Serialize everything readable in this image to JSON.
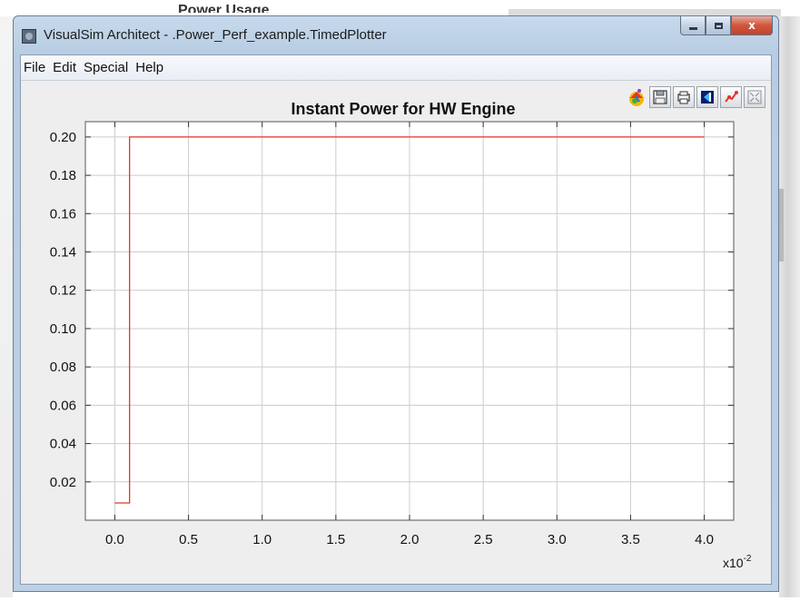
{
  "background": {
    "partial_title": "Power Usage"
  },
  "window": {
    "title": "VisualSim Architect - .Power_Perf_example.TimedPlotter",
    "close_label": "x"
  },
  "menu": {
    "items": [
      "File",
      "Edit",
      "Special",
      "Help"
    ]
  },
  "toolbar": {
    "icons": [
      "fill-icon",
      "save-icon",
      "print-icon",
      "reset-axes-icon",
      "format-icon",
      "fullscreen-icon"
    ]
  },
  "colors": {
    "series": "#e8332a",
    "grid": "#cccccc",
    "plot_bg": "#ffffff"
  },
  "chart_data": {
    "type": "line",
    "title": "Instant Power for HW Engine",
    "xlabel": "",
    "ylabel": "",
    "x_multiplier": "x10",
    "x_multiplier_exp": "-2",
    "xlim": [
      -0.2,
      4.2
    ],
    "ylim": [
      0.0,
      0.208
    ],
    "x_ticks": [
      0.0,
      0.5,
      1.0,
      1.5,
      2.0,
      2.5,
      3.0,
      3.5,
      4.0
    ],
    "x_tick_labels": [
      "0.0",
      "0.5",
      "1.0",
      "1.5",
      "2.0",
      "2.5",
      "3.0",
      "3.5",
      "4.0"
    ],
    "y_ticks": [
      0.02,
      0.04,
      0.06,
      0.08,
      0.1,
      0.12,
      0.14,
      0.16,
      0.18,
      0.2
    ],
    "y_tick_labels": [
      "0.02",
      "0.04",
      "0.06",
      "0.08",
      "0.10",
      "0.12",
      "0.14",
      "0.16",
      "0.18",
      "0.20"
    ],
    "grid": true,
    "series": [
      {
        "step": true,
        "x": [
          0.0,
          0.1,
          0.1,
          4.0
        ],
        "y": [
          0.009,
          0.009,
          0.2,
          0.2
        ]
      }
    ]
  }
}
